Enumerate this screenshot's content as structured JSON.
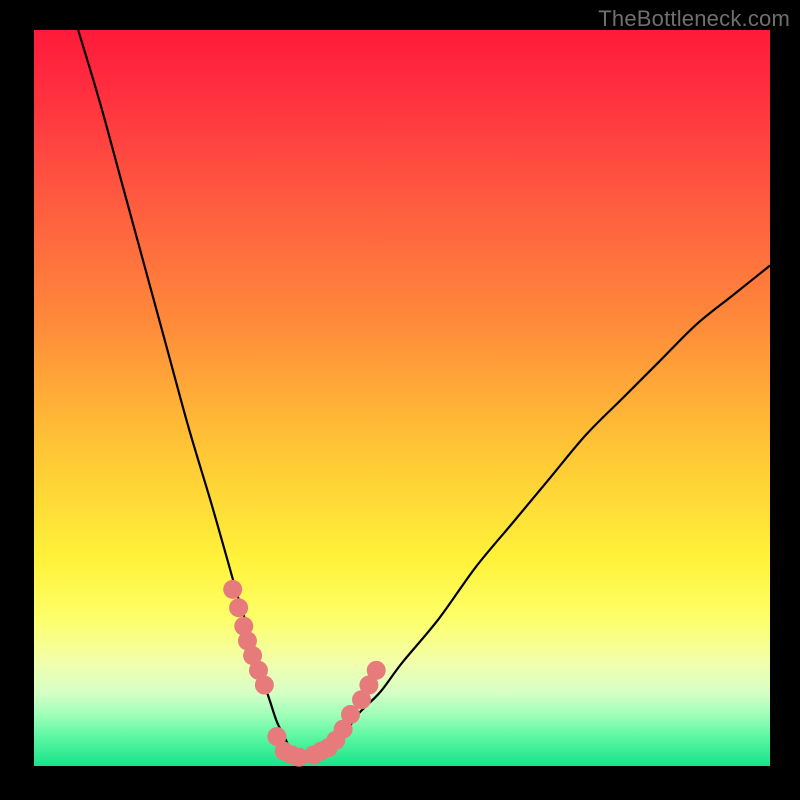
{
  "watermark": "TheBottleneck.com",
  "colors": {
    "frame": "#000000",
    "curve": "#000000",
    "marker": "#e77b7c",
    "grad_top": "#ff1a3a",
    "grad_bottom": "#18e38b"
  },
  "chart_data": {
    "type": "line",
    "title": "",
    "xlabel": "",
    "ylabel": "",
    "xlim": [
      0,
      100
    ],
    "ylim": [
      0,
      100
    ],
    "grid": false,
    "legend": false,
    "series": [
      {
        "name": "bottleneck-curve",
        "x": [
          6,
          9,
          12,
          15,
          18,
          21,
          24,
          26,
          28,
          30,
          31,
          32,
          33,
          34,
          35,
          36,
          37,
          38,
          40,
          42,
          44,
          47,
          50,
          55,
          60,
          65,
          70,
          75,
          80,
          85,
          90,
          95,
          100
        ],
        "y": [
          100,
          90,
          79,
          68,
          57,
          46,
          36,
          29,
          22,
          16,
          12,
          9,
          6,
          4,
          2,
          1,
          1,
          1,
          2,
          4,
          7,
          10,
          14,
          20,
          27,
          33,
          39,
          45,
          50,
          55,
          60,
          64,
          68
        ]
      }
    ],
    "markers": {
      "name": "highlight-dots",
      "x": [
        27.0,
        27.8,
        28.5,
        29.0,
        29.7,
        30.5,
        31.3,
        33.0,
        34.0,
        35.0,
        36.0,
        38.0,
        39.0,
        40.0,
        41.0,
        42.0,
        43.0,
        44.5,
        45.5,
        46.5
      ],
      "y": [
        24.0,
        21.5,
        19.0,
        17.0,
        15.0,
        13.0,
        11.0,
        4.0,
        2.0,
        1.5,
        1.2,
        1.5,
        2.0,
        2.5,
        3.5,
        5.0,
        7.0,
        9.0,
        11.0,
        13.0
      ]
    }
  }
}
